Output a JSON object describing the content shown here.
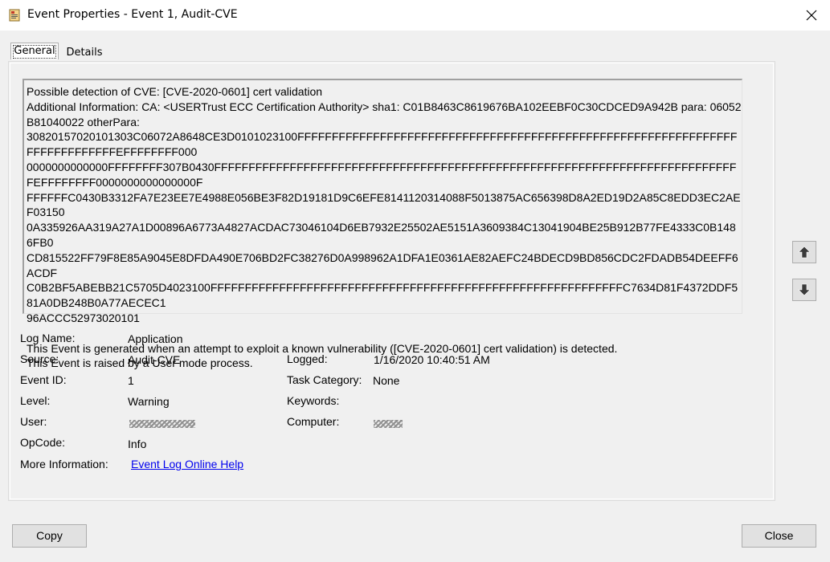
{
  "window": {
    "title": "Event Properties - Event 1, Audit-CVE",
    "close_label": "×"
  },
  "tabs": [
    {
      "label": "General",
      "selected": true
    },
    {
      "label": "Details",
      "selected": false
    }
  ],
  "description": "Possible detection of CVE: [CVE-2020-0601] cert validation\nAdditional Information: CA: <USERTrust ECC Certification Authority> sha1: C01B8463C8619676BA102EEBF0C30CDCED9A942B para: 06052B81040022 otherPara:\n30820157020101303C06072A8648CE3D0101023100FFFFFFFFFFFFFFFFFFFFFFFFFFFFFFFFFFFFFFFFFFFFFFFFFFFFFFFFFFFFFFFFFFFFFFFFFFFFFEFFFFFFFF000\n0000000000000FFFFFFFF307B0430FFFFFFFFFFFFFFFFFFFFFFFFFFFFFFFFFFFFFFFFFFFFFFFFFFFFFFFFFFFFFFFFFFFFFFFFFFFFFEFFFFFFFF0000000000000000F\nFFFFFFC0430B3312FA7E23EE7E4988E056BE3F82D19181D9C6EFE8141120314088F5013875AC656398D8A2ED19D2A85C8EDD3EC2AEF03150\n0A335926AA319A27A1D00896A6773A4827ACDAC73046104D6EB7932E25502AE5151A3609384C13041904BE25B912B77FE4333C0B1486FB0\nCD815522FF79F8E85A9045E8DFDA490E706BD2FC38276D0A998962A1DFA1E0361AE82AEFC24BDECD9BD856CDC2FDADB54DEEFF6ACDF\nC0B2BF5ABEBB21C5705D4023100FFFFFFFFFFFFFFFFFFFFFFFFFFFFFFFFFFFFFFFFFFFFFFFFFFFFFFFFFFFFC7634D81F4372DDF581A0DB248B0A77AECEC1\n96ACCC52973020101\n\nThis Event is generated when an attempt to exploit a known vulnerability ([CVE-2020-0601] cert validation) is detected.\nThis Event is raised by a User mode process.",
  "fields": {
    "log_name": {
      "label": "Log Name:",
      "value": "Application"
    },
    "source": {
      "label": "Source:",
      "value": "Audit-CVE"
    },
    "event_id": {
      "label": "Event ID:",
      "value": "1"
    },
    "level": {
      "label": "Level:",
      "value": "Warning"
    },
    "user": {
      "label": "User:",
      "value": ""
    },
    "opcode": {
      "label": "OpCode:",
      "value": "Info"
    },
    "more_info": {
      "label": "More Information:",
      "link": "Event Log Online Help"
    },
    "logged": {
      "label": "Logged:",
      "value": "1/16/2020 10:40:51 AM"
    },
    "task_category": {
      "label": "Task Category:",
      "value": "None"
    },
    "keywords": {
      "label": "Keywords:",
      "value": ""
    },
    "computer": {
      "label": "Computer:",
      "value": ""
    }
  },
  "buttons": {
    "copy": "Copy",
    "close": "Close"
  },
  "icons": {
    "app": "event-viewer-icon",
    "up": "arrow-up-icon",
    "down": "arrow-down-icon"
  }
}
